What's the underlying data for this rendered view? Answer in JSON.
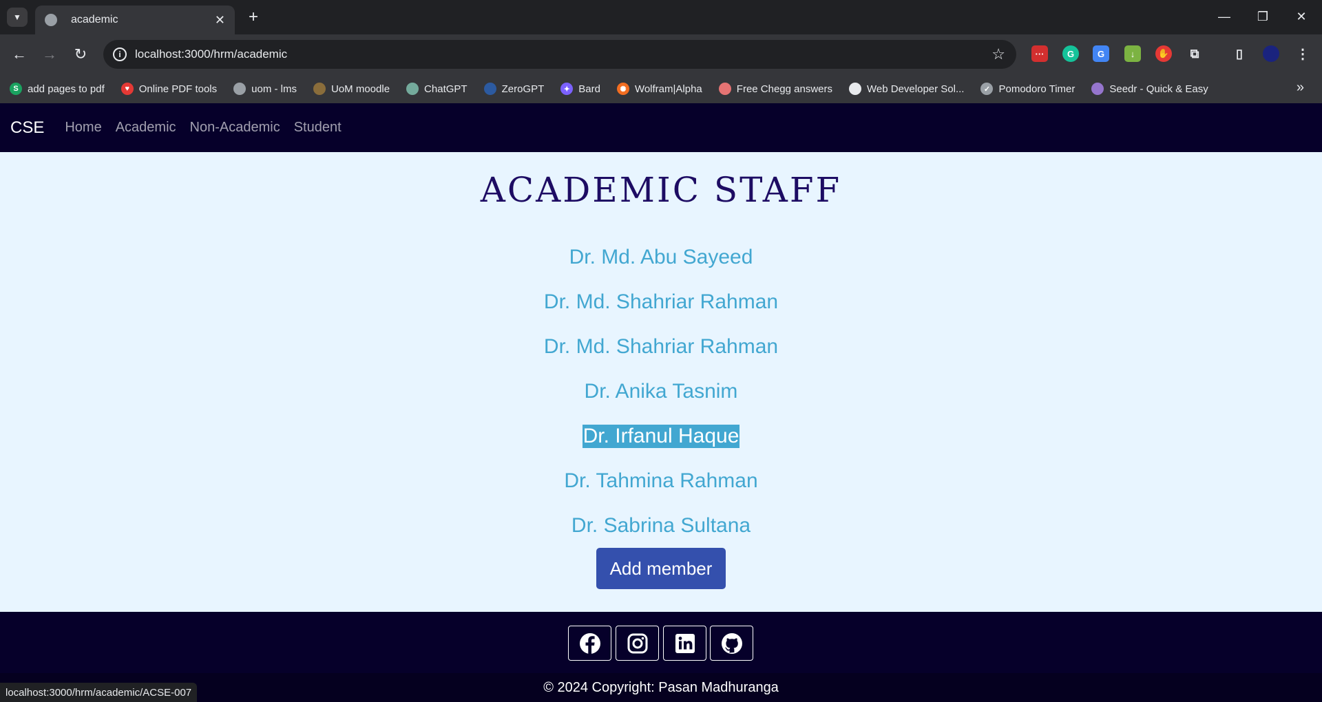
{
  "browser": {
    "tab_title": "academic",
    "url": "localhost:3000/hrm/academic",
    "bookmarks": [
      {
        "label": "add pages to pdf",
        "color": "#1aa260",
        "glyph": "S"
      },
      {
        "label": "Online PDF tools",
        "color": "#e53935",
        "glyph": "♥"
      },
      {
        "label": "uom - lms",
        "color": "#9aa0a6",
        "glyph": ""
      },
      {
        "label": "UoM moodle",
        "color": "#8a6d3b",
        "glyph": ""
      },
      {
        "label": "ChatGPT",
        "color": "#74aa9c",
        "glyph": ""
      },
      {
        "label": "ZeroGPT",
        "color": "#2c5aa0",
        "glyph": ""
      },
      {
        "label": "Bard",
        "color": "#7b61ff",
        "glyph": "✦"
      },
      {
        "label": "Wolfram|Alpha",
        "color": "#f26d21",
        "glyph": "✺"
      },
      {
        "label": "Free Chegg answers",
        "color": "#e57373",
        "glyph": ""
      },
      {
        "label": "Web Developer Sol...",
        "color": "#e8eaed",
        "glyph": ""
      },
      {
        "label": "Pomodoro Timer",
        "color": "#9aa0a6",
        "glyph": "✓"
      },
      {
        "label": "Seedr - Quick & Easy",
        "color": "#9575cd",
        "glyph": ""
      }
    ],
    "status_url": "localhost:3000/hrm/academic/ACSE-007"
  },
  "nav": {
    "brand": "CSE",
    "links": [
      "Home",
      "Academic",
      "Non-Academic",
      "Student"
    ]
  },
  "main": {
    "title": "ACADEMIC STAFF",
    "staff": [
      "Dr. Md. Abu Sayeed",
      "Dr. Md. Shahriar Rahman",
      "Dr. Md. Shahriar Rahman",
      "Dr. Anika Tasnim",
      "Dr. Irfanul Haque",
      "Dr. Tahmina Rahman",
      "Dr. Sabrina Sultana"
    ],
    "add_button": "Add member"
  },
  "footer": {
    "social_icons": [
      "facebook-icon",
      "instagram-icon",
      "linkedin-icon",
      "github-icon"
    ],
    "copyright": "© 2024 Copyright: Pasan Madhuranga"
  }
}
